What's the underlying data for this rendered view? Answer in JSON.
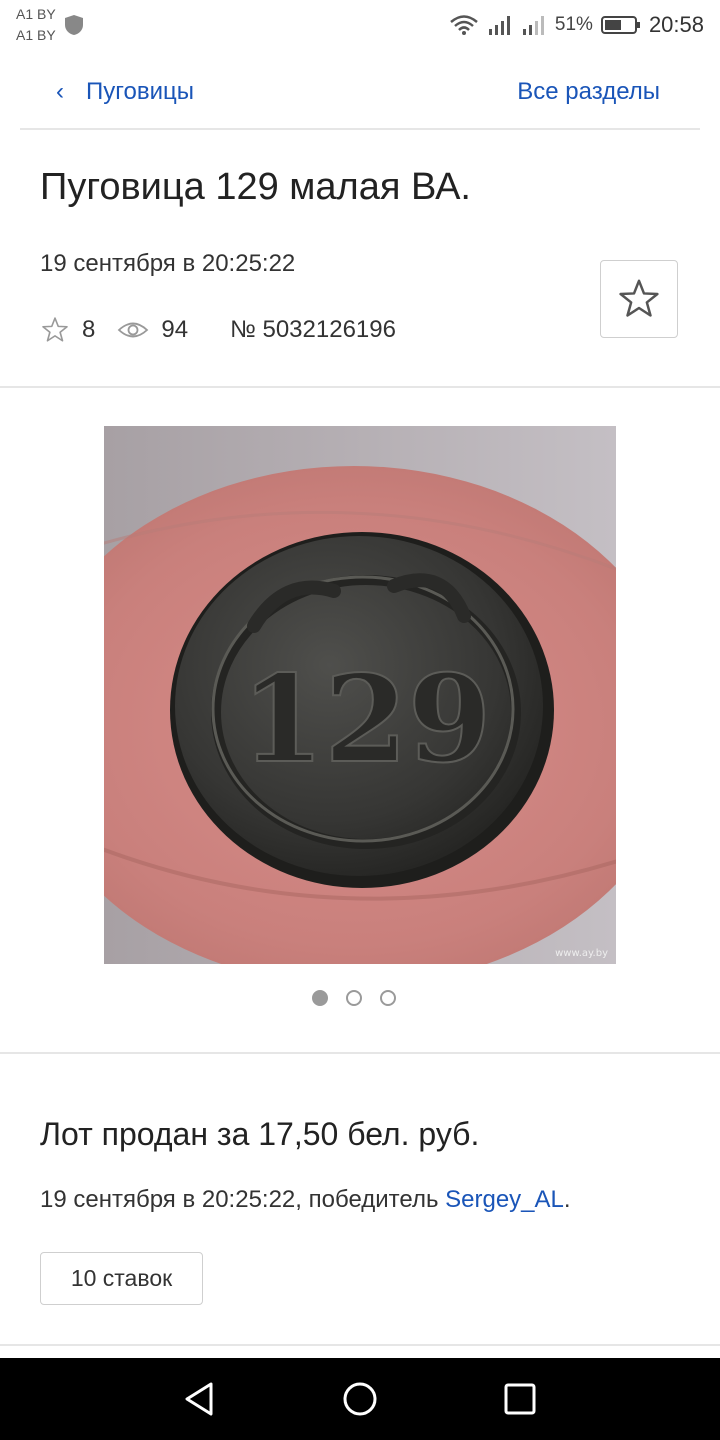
{
  "status_bar": {
    "carrier_1": "A1 BY",
    "carrier_2": "A1 BY",
    "battery_percent": "51%",
    "time": "20:58",
    "icons": [
      "shield-icon",
      "wifi-icon",
      "signal-icon",
      "signal-icon",
      "battery-icon"
    ]
  },
  "nav": {
    "back_label": "Пуговицы",
    "back_icon": "chevron-left-icon",
    "all_sections_label": "Все разделы"
  },
  "lot": {
    "title": "Пуговица 129 малая ВА.",
    "date": "19 сентября в 20:25:22",
    "favorites_count": "8",
    "views_count": "94",
    "lot_number": "№ 5032126196",
    "favorite_button_icon": "star-outline-icon"
  },
  "gallery": {
    "image_count": 3,
    "active_index": 0,
    "watermark": "www.ay.by",
    "coin_text": "129"
  },
  "result": {
    "sold_text": "Лот продан за 17,50 бел. руб.",
    "sold_date_prefix": "19 сентября в 20:25:22, победитель ",
    "winner": "Sergey_AL",
    "suffix": ".",
    "bids_button": "10 ставок"
  },
  "colors": {
    "link": "#1a55b8",
    "divider": "#e6e6e6",
    "navbar": "#000000"
  }
}
